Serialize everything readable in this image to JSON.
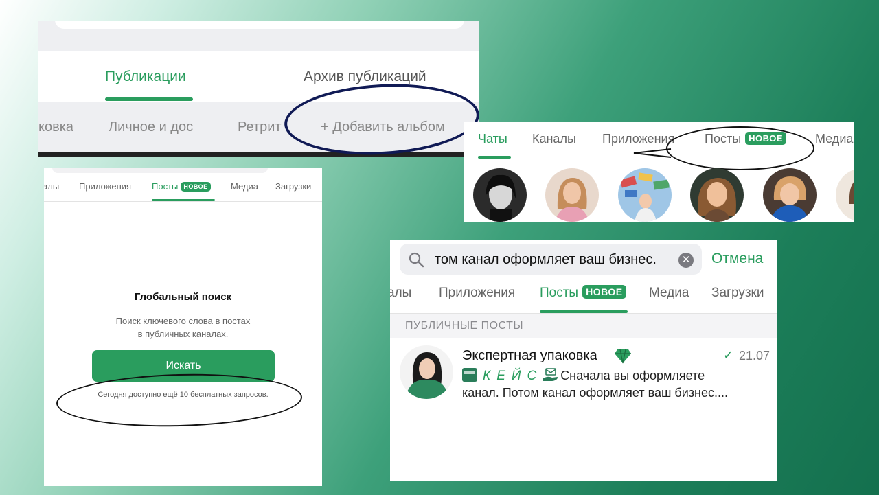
{
  "colors": {
    "accent": "#2a9d5e",
    "circle_dark": "#101a55",
    "circle_black": "#111111"
  },
  "panel_a": {
    "tabs": [
      "Публикации",
      "Архив публикаций"
    ],
    "albums": [
      "ковка",
      "Личное и дос",
      "Ретрит",
      "+ Добавить альбом"
    ]
  },
  "panel_b": {
    "tabs": [
      "Чаты",
      "Каналы",
      "Приложения",
      "Посты",
      "Медиа"
    ],
    "badge": "НОВОЕ"
  },
  "panel_c": {
    "tabs": [
      "алы",
      "Приложения",
      "Посты",
      "Медиа",
      "Загрузки"
    ],
    "badge": "НОВОЕ",
    "title": "Глобальный поиск",
    "desc_line1": "Поиск ключевого слова в постах",
    "desc_line2": "в публичных каналах.",
    "button": "Искать",
    "quota": "Сегодня доступно ещё 10 бесплатных запросов."
  },
  "panel_d": {
    "query": "том канал оформляет ваш бизнес.",
    "cancel": "Отмена",
    "tabs": [
      "алы",
      "Приложения",
      "Посты",
      "Медиа",
      "Загрузки"
    ],
    "badge": "НОВОЕ",
    "section": "ПУБЛИЧНЫЕ ПОСТЫ",
    "result": {
      "name": "Экспертная упаковка",
      "date": "21.07",
      "keys": "КЕЙС",
      "snippet_a": "Сначала вы оформляете",
      "snippet_b": "канал. Потом канал оформляет ваш бизнес...."
    }
  }
}
